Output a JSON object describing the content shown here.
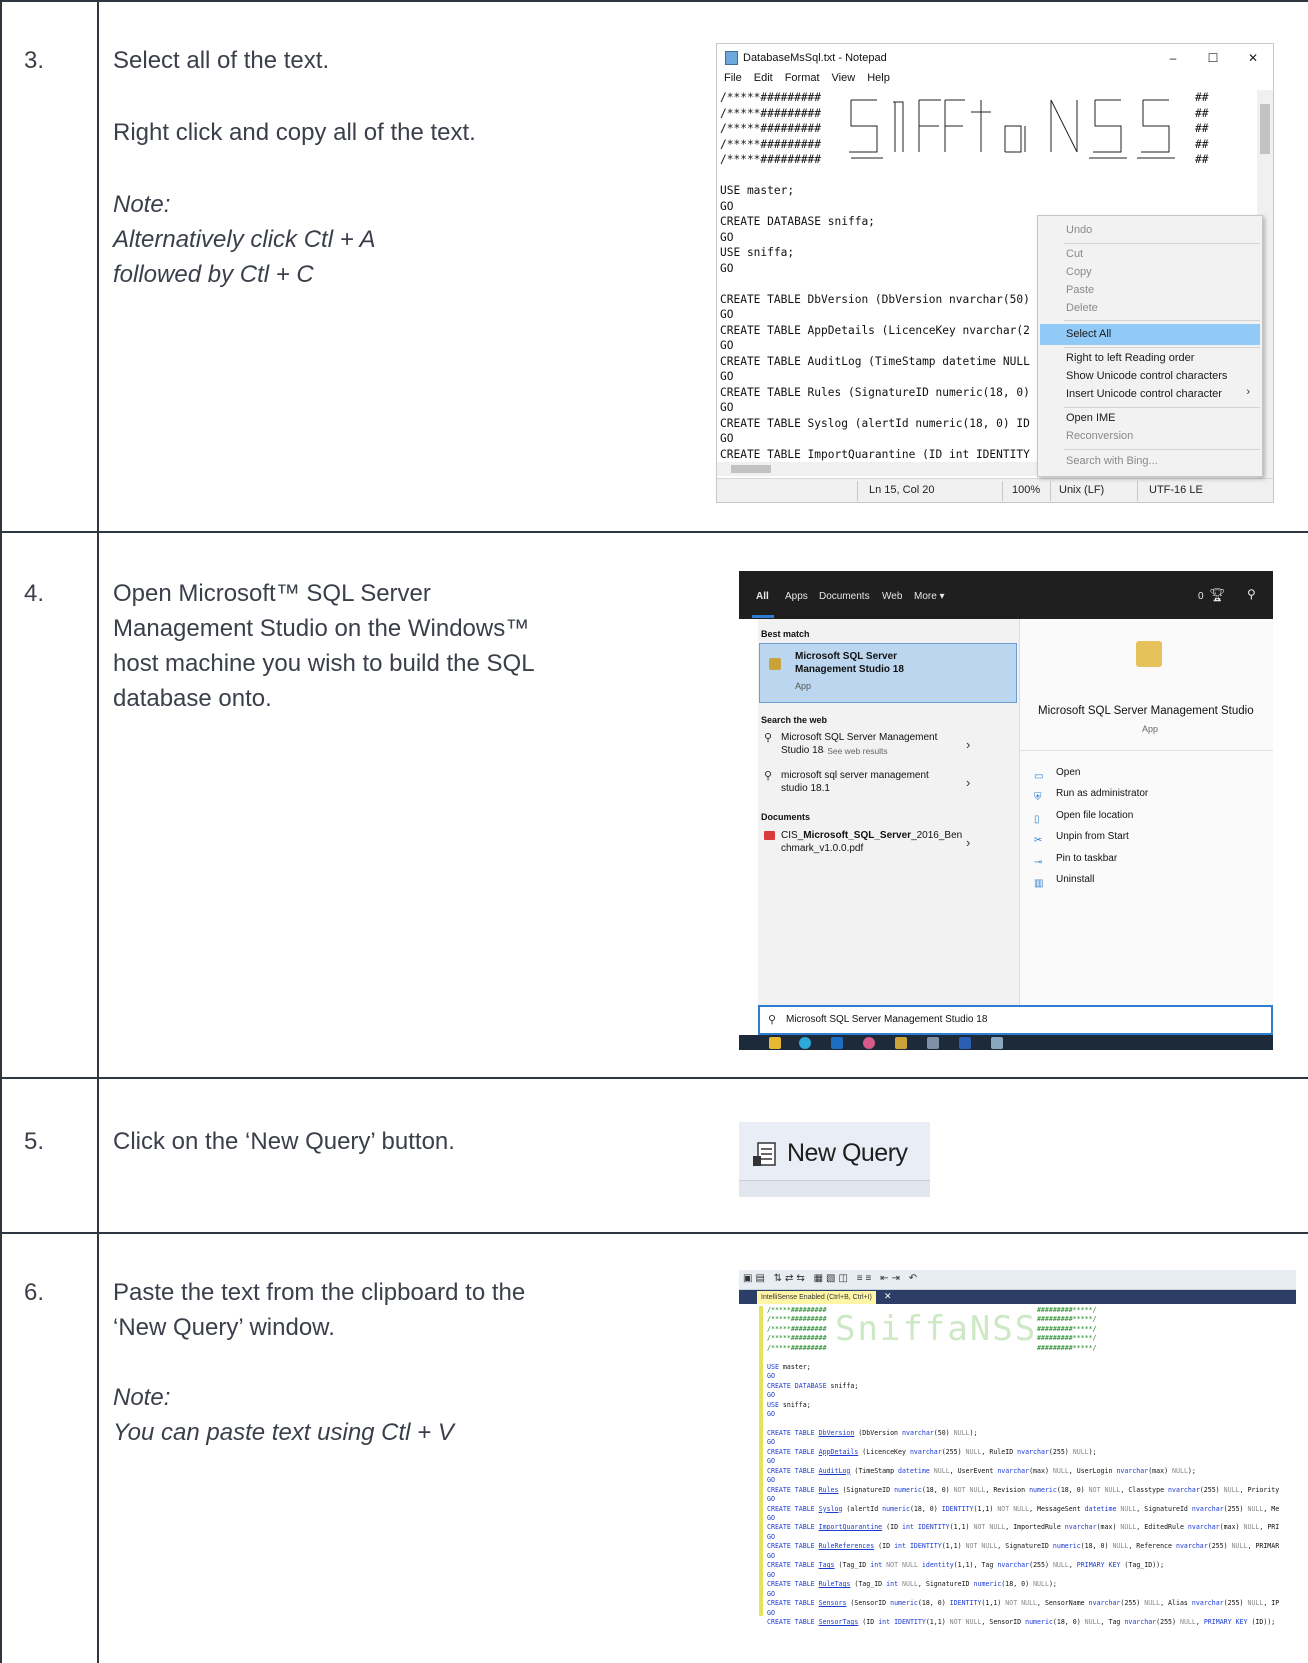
{
  "steps": [
    {
      "number": "3.",
      "text": [
        "Select all of the text.",
        "Right click and copy all of the text."
      ],
      "note_label": "Note:",
      "note_lines": [
        "Alternatively click Ctl + A",
        "followed by Ctl + C"
      ]
    },
    {
      "number": "4.",
      "text": [
        "Open Microsoft™ SQL Server",
        "Management Studio on the Windows™",
        "host machine you wish to build the SQL",
        "database onto."
      ]
    },
    {
      "number": "5.",
      "text": [
        "Click on the ‘New Query’ button."
      ]
    },
    {
      "number": "6.",
      "text": [
        "Paste the text from the clipboard to the",
        "‘New Query’ window."
      ],
      "note_label": "Note:",
      "note_lines": [
        "You can paste text using Ctl + V"
      ]
    }
  ],
  "notepad": {
    "title": "DatabaseMsSql.txt - Notepad",
    "controls": [
      "–",
      "☐",
      "✕"
    ],
    "menu": [
      "File",
      "Edit",
      "Format",
      "View",
      "Help"
    ],
    "lines": [
      "/*****#########",
      "/*****#########",
      "/*****#########",
      "/*****#########",
      "/*****#########",
      "",
      "USE master;",
      "GO",
      "CREATE DATABASE sniffa;",
      "GO",
      "USE sniffa;",
      "GO",
      "",
      "CREATE TABLE DbVersion (DbVersion nvarchar(50)",
      "GO",
      "CREATE TABLE AppDetails (LicenceKey nvarchar(2",
      "GO",
      "CREATE TABLE AuditLog (TimeStamp datetime NULL",
      "GO",
      "CREATE TABLE Rules (SignatureID numeric(18, 0)",
      "GO",
      "CREATE TABLE Syslog (alertId numeric(18, 0) ID",
      "GO",
      "CREATE TABLE ImportQuarantine (ID int IDENTITY"
    ],
    "right_marks": [
      "##",
      "##",
      "##",
      "##",
      "##"
    ],
    "context_menu": {
      "items": [
        {
          "label": "Undo",
          "enabled": false
        },
        {
          "label": "Cut",
          "enabled": false
        },
        {
          "label": "Copy",
          "enabled": false
        },
        {
          "label": "Paste",
          "enabled": false
        },
        {
          "label": "Delete",
          "enabled": false
        },
        {
          "label": "Select All",
          "enabled": true,
          "highlighted": true
        },
        {
          "label": "Right to left Reading order",
          "enabled": true
        },
        {
          "label": "Show Unicode control characters",
          "enabled": true
        },
        {
          "label": "Insert Unicode control character",
          "enabled": true
        },
        {
          "label": "Open IME",
          "enabled": true
        },
        {
          "label": "Reconversion",
          "enabled": false
        },
        {
          "label": "Search with Bing...",
          "enabled": false
        }
      ]
    },
    "status": {
      "position": "Ln 15, Col 20",
      "zoom": "100%",
      "line_ending": "Unix (LF)",
      "encoding": "UTF-16 LE"
    }
  },
  "windows_search": {
    "tabs": [
      "All",
      "Apps",
      "Documents",
      "Web",
      "More ▾"
    ],
    "count": "0",
    "best_match_header": "Best match",
    "best_match_title_1": "Microsoft SQL Server",
    "best_match_title_2": "Management Studio 18",
    "best_match_type": "App",
    "search_web_header": "Search the web",
    "web_result_1a": "Microsoft SQL Server Management",
    "web_result_1b": "Studio 18",
    "web_result_1c": " - See web results",
    "web_result_2a": "microsoft sql server management",
    "web_result_2b": "studio 18.1",
    "documents_header": "Documents",
    "doc_1a_pre": "CIS_",
    "doc_1a_bold": "Microsoft_SQL_Server",
    "doc_1a_post": "_2016_Ben",
    "doc_1b": "chmark_v1.0.0.pdf",
    "app_title": "Microsoft SQL Server Management Studio",
    "app_type": "App",
    "actions": [
      "Open",
      "Run as administrator",
      "Open file location",
      "Unpin from Start",
      "Pin to taskbar",
      "Uninstall"
    ],
    "query": "Microsoft SQL Server Management Studio 18"
  },
  "new_query": {
    "label": "New Query"
  },
  "ssms": {
    "tab_label": "IntelliSense Enabled (Ctrl+B, Ctrl+I)",
    "banner": "SniffaNSS"
  }
}
